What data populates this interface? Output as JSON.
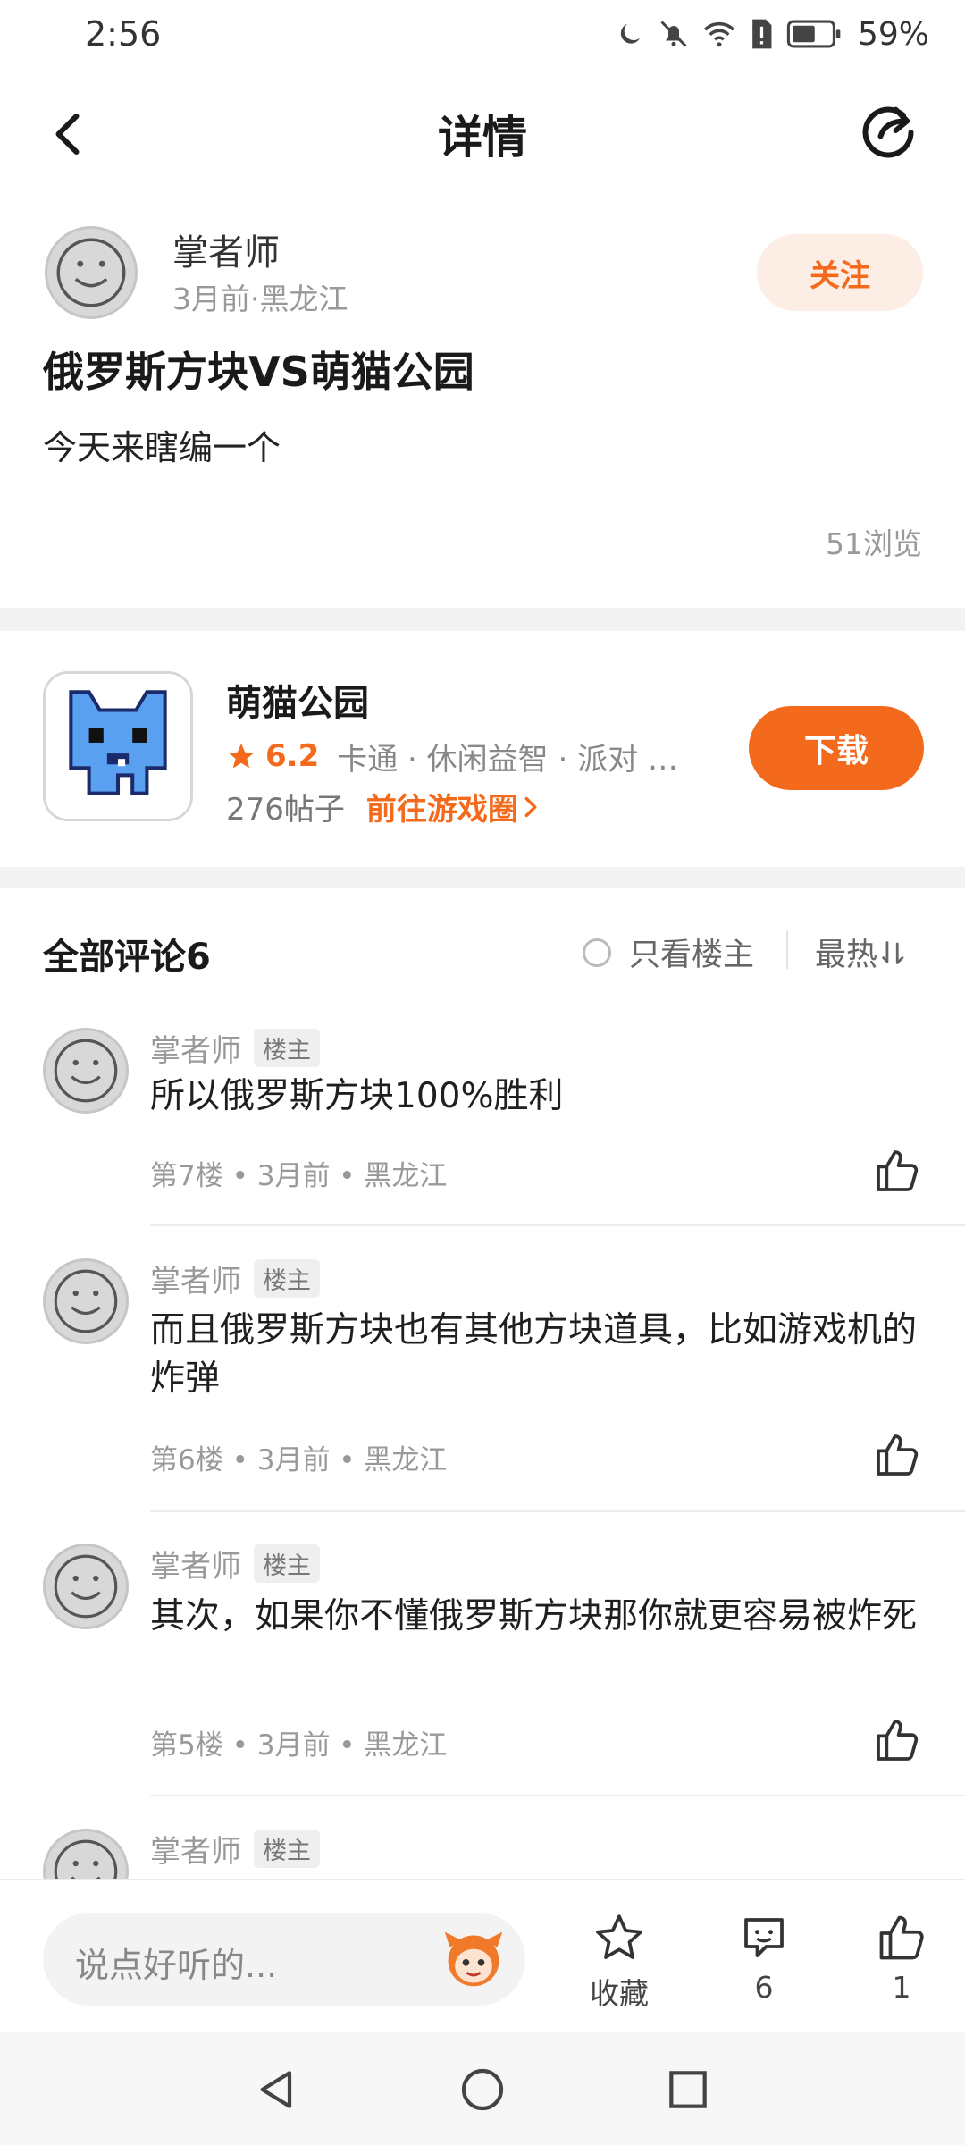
{
  "status_bar": {
    "time": "2:56",
    "battery": "59%"
  },
  "header": {
    "title": "详情"
  },
  "author": {
    "name": "掌者师",
    "meta": "3月前·黑龙江",
    "follow_label": "关注"
  },
  "post": {
    "title": "俄罗斯方块VS萌猫公园",
    "body": "今天来瞎编一个",
    "views": "51浏览"
  },
  "game": {
    "name": "萌猫公园",
    "rating": "6.2",
    "tags": "卡通 · 休闲益智 · 派对 …",
    "posts": "276帖子",
    "goto_label": "前往游戏圈",
    "download_label": "下载"
  },
  "comments_header": {
    "title": "全部评论6",
    "only_op": "只看楼主",
    "sort": "最热"
  },
  "comments": [
    {
      "author": "掌者师",
      "badge": "楼主",
      "text": "所以俄罗斯方块100%胜利",
      "meta": "第7楼 • 3月前 • 黑龙江"
    },
    {
      "author": "掌者师",
      "badge": "楼主",
      "text": "而且俄罗斯方块也有其他方块道具，比如游戏机的炸弹",
      "meta": "第6楼 • 3月前 • 黑龙江"
    },
    {
      "author": "掌者师",
      "badge": "楼主",
      "text": "其次，如果你不懂俄罗斯方块那你就更容易被炸死",
      "meta": "第5楼 • 3月前 • 黑龙江"
    },
    {
      "author": "掌者师",
      "badge": "楼主"
    }
  ],
  "bottom_bar": {
    "input_placeholder": "说点好听的...",
    "favorite_label": "收藏",
    "comment_count": "6",
    "like_count": "1"
  },
  "colors": {
    "accent": "#f46a1c",
    "follow_bg": "#fdeee5",
    "game_icon_blue": "#5aa0f0"
  }
}
